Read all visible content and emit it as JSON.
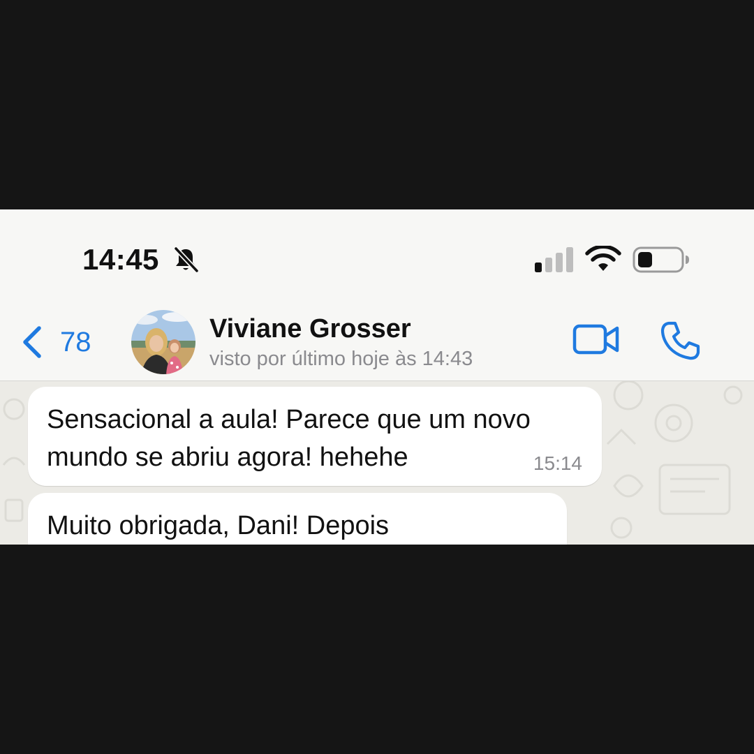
{
  "status_bar": {
    "time": "14:45",
    "icons": [
      "bell-slash-icon",
      "cellular-signal-icon",
      "wifi-icon",
      "battery-icon"
    ]
  },
  "header": {
    "back_count": "78",
    "contact_name": "Viviane Grosser",
    "contact_status": "visto por último hoje às 14:43",
    "icons": [
      "chevron-left-icon",
      "video-camera-icon",
      "phone-icon"
    ]
  },
  "messages": [
    {
      "line1": "Sensacional a aula! Parece que um novo",
      "line2": "mundo se abriu agora! hehehe",
      "time": "15:14"
    },
    {
      "line1": "Muito obrigada, Dani! Depois"
    }
  ],
  "colors": {
    "accent": "#1f7ae0",
    "background_frame": "#151515",
    "header_background": "#f7f7f5",
    "chat_background": "#ecebe6",
    "bubble": "#ffffff"
  }
}
